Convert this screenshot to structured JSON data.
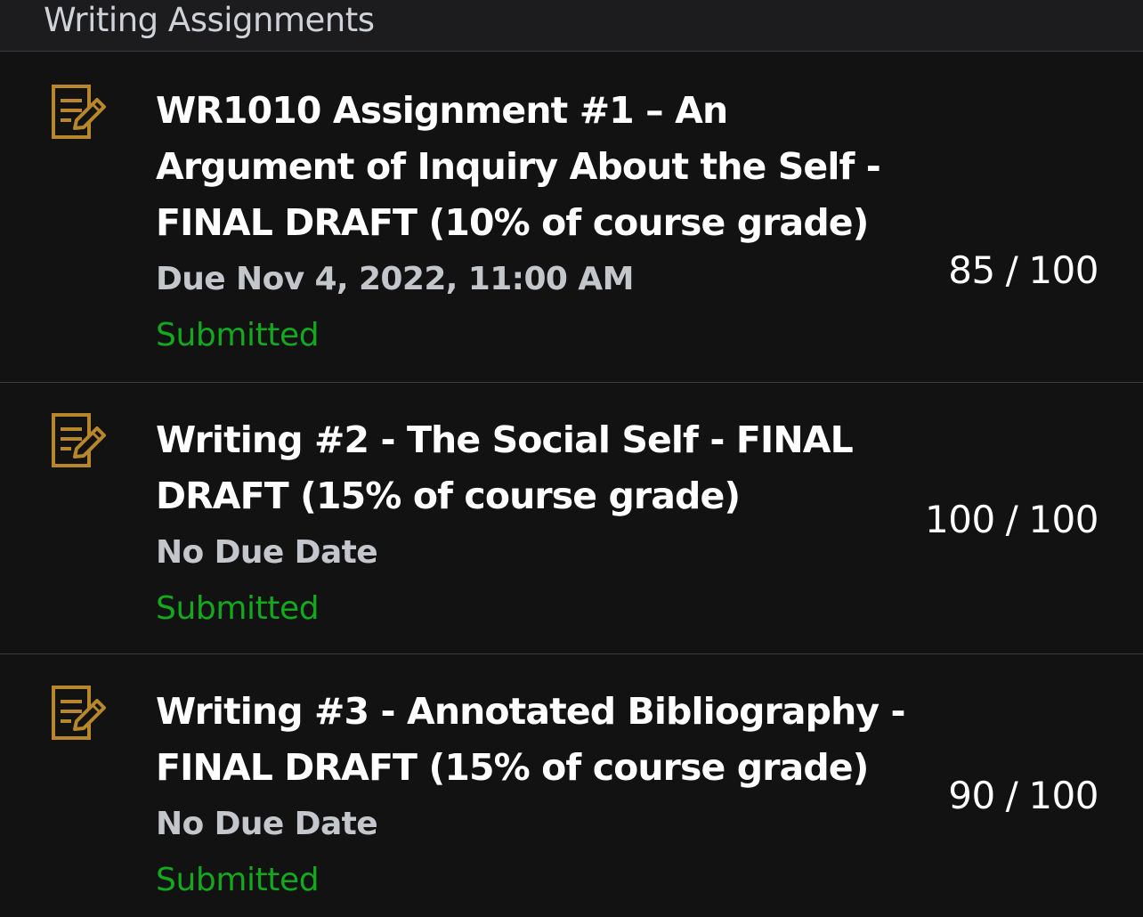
{
  "section": {
    "title": "Writing Assignments"
  },
  "colors": {
    "background": "#121212",
    "header_background": "#1c1c1e",
    "icon": "#b8862b",
    "submitted": "#14a81f",
    "due_text": "#c3c6cb"
  },
  "assignments": [
    {
      "icon": "assignment-icon",
      "title": "WR1010 Assignment #1 – An Argument of Inquiry About the Self - FINAL DRAFT (10% of course grade)",
      "due": "Due Nov 4, 2022, 11:00 AM",
      "status": "Submitted",
      "score": "85",
      "separator": "/",
      "total": "100"
    },
    {
      "icon": "assignment-icon",
      "title": "Writing #2 - The Social Self - FINAL DRAFT (15% of course grade)",
      "due": "No Due Date",
      "status": "Submitted",
      "score": "100",
      "separator": "/",
      "total": "100"
    },
    {
      "icon": "assignment-icon",
      "title": "Writing #3 - Annotated Bibliography - FINAL DRAFT (15% of course grade)",
      "due": "No Due Date",
      "status": "Submitted",
      "score": "90",
      "separator": "/",
      "total": "100"
    }
  ]
}
